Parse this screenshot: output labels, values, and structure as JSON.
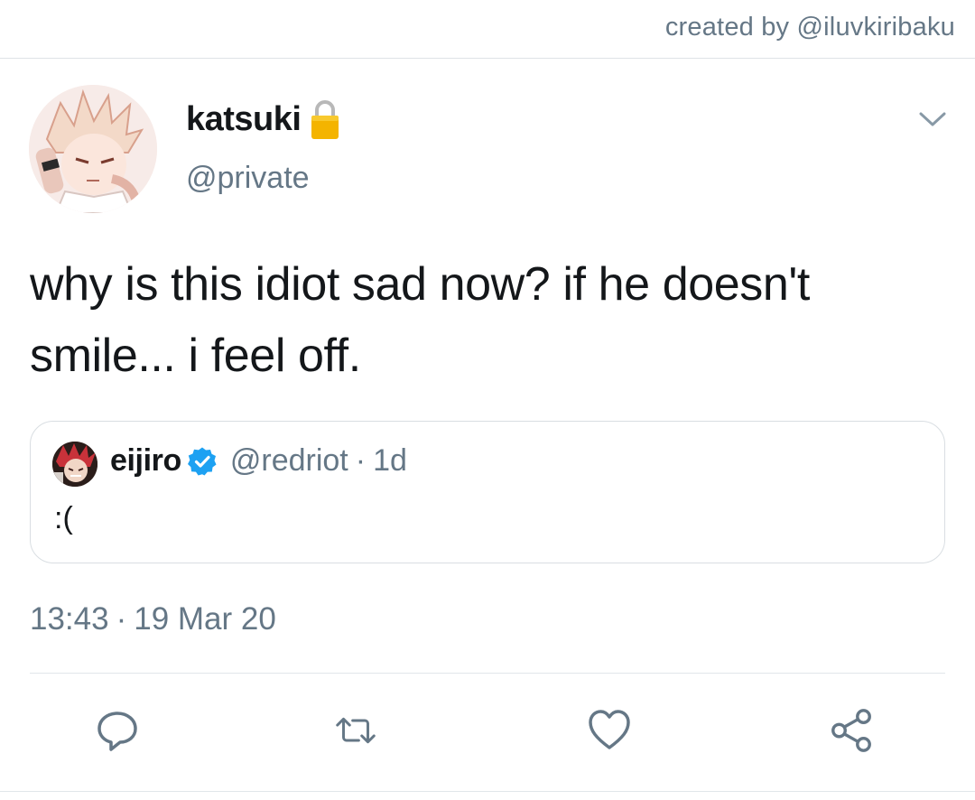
{
  "credit": {
    "text": "created by @iluvkiribaku"
  },
  "tweet": {
    "author": {
      "display_name": "katsuki",
      "handle": "@private",
      "protected": true
    },
    "text": "why is this idiot sad now? if he doesn't smile... i feel off.",
    "timestamp": {
      "time": "13:43",
      "separator": "·",
      "date": "19 Mar 20"
    }
  },
  "quote": {
    "author": {
      "display_name": "eijiro",
      "handle": "@redriot",
      "verified": true
    },
    "separator": "·",
    "age": "1d",
    "text": ":("
  },
  "actions": [
    {
      "icon": "reply-icon"
    },
    {
      "icon": "retweet-icon"
    },
    {
      "icon": "like-icon"
    },
    {
      "icon": "share-icon"
    }
  ],
  "colors": {
    "text_primary": "#14171a",
    "text_secondary": "#657786",
    "border": "#dfe3e6",
    "verified_blue": "#1da1f2",
    "lock_gold": "#f4b400"
  }
}
